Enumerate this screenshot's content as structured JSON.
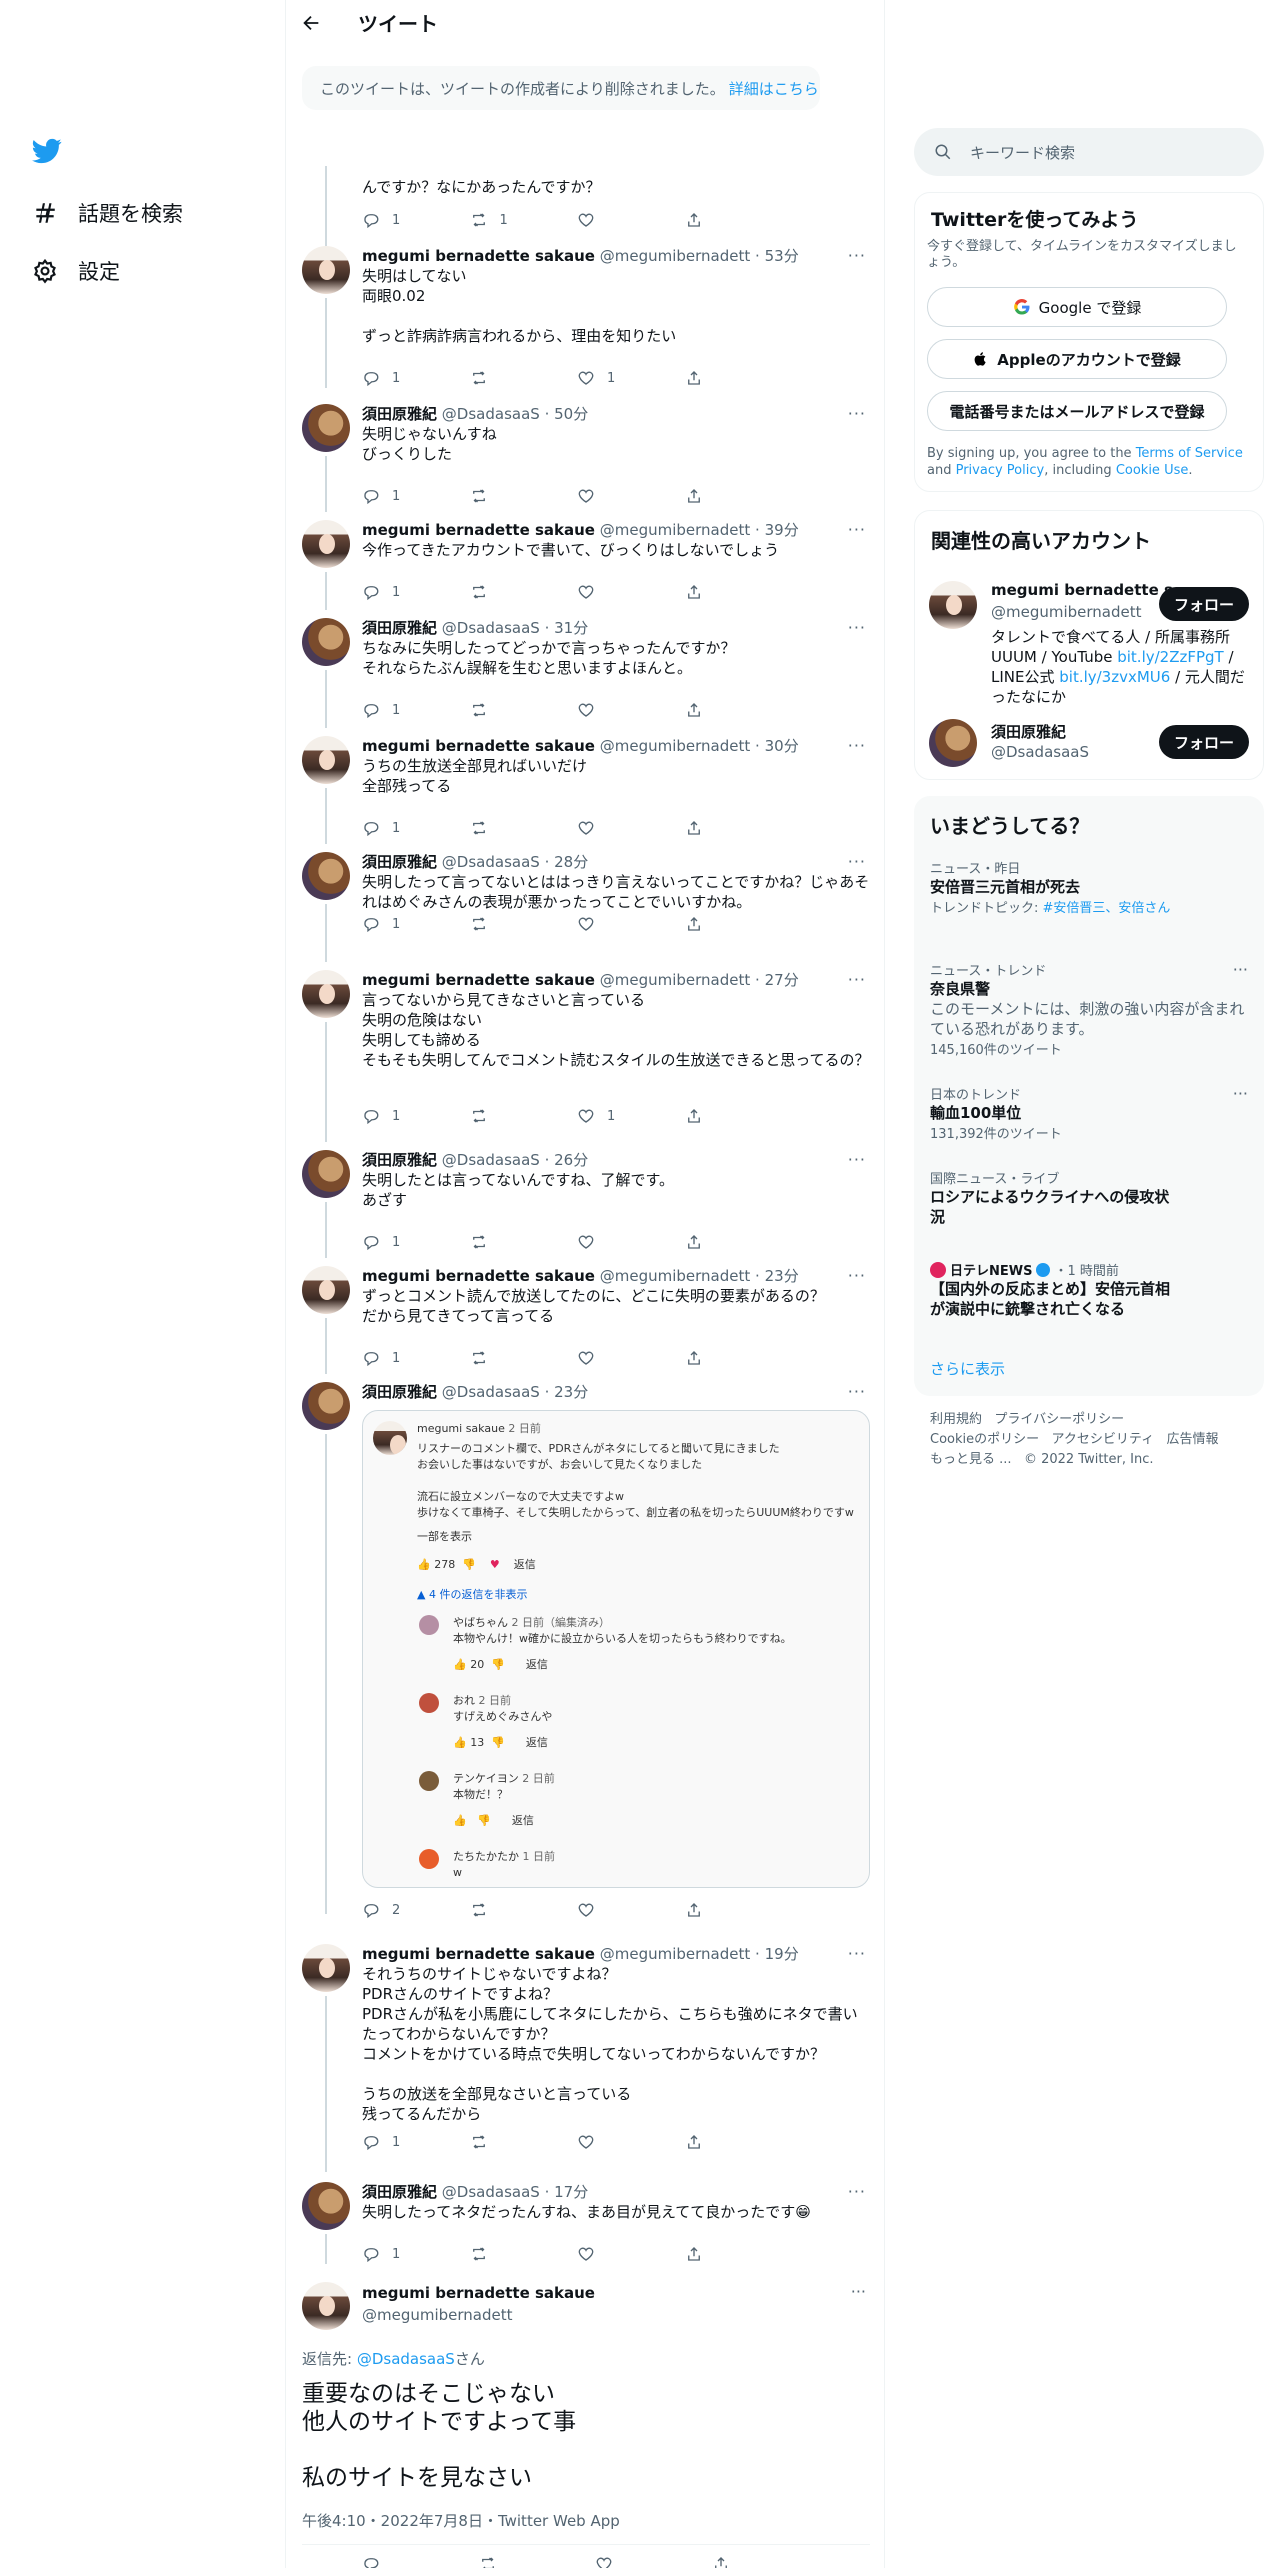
{
  "nav": {
    "explore_label": "話題を検索",
    "settings_label": "設定"
  },
  "header": {
    "title": "ツイート"
  },
  "deleted_notice": {
    "text": "このツイートは、ツイートの作成者により削除されました。",
    "link": "詳細はこちら"
  },
  "top_partial": {
    "text": "んですか？なにかあったんですか？",
    "reply": "1",
    "retweet": "1"
  },
  "tweets": [
    {
      "name": "megumi bernadette sakaue",
      "handle": "@megumibernadett",
      "time": "53分",
      "text": "失明はしてない\n両眼0.02\n\nずっと詐病詐病言われるから、理由を知りたい",
      "reply": "1",
      "retweet": "",
      "like": "1"
    },
    {
      "name": "須田原雅紀",
      "handle": "@DsadasaaS",
      "time": "50分",
      "text": "失明じゃないんすね\nびっくりした",
      "reply": "1",
      "retweet": "",
      "like": ""
    },
    {
      "name": "megumi bernadette sakaue",
      "handle": "@megumibernadett",
      "time": "39分",
      "text": "今作ってきたアカウントで書いて、びっくりはしないでしょう",
      "reply": "1",
      "retweet": "",
      "like": ""
    },
    {
      "name": "須田原雅紀",
      "handle": "@DsadasaaS",
      "time": "31分",
      "text": "ちなみに失明したってどっかで言っちゃったんですか？\nそれならたぶん誤解を生むと思いますよほんと。",
      "reply": "1",
      "retweet": "",
      "like": ""
    },
    {
      "name": "megumi bernadette sakaue",
      "handle": "@megumibernadett",
      "time": "30分",
      "text": "うちの生放送全部見ればいいだけ\n全部残ってる",
      "reply": "1",
      "retweet": "",
      "like": ""
    },
    {
      "name": "須田原雅紀",
      "handle": "@DsadasaaS",
      "time": "28分",
      "text": "失明したって言ってないとははっきり言えないってことですかね？じゃあそれはめぐみさんの表現が悪かったってことでいいすかね。",
      "reply": "1",
      "retweet": "",
      "like": ""
    },
    {
      "name": "megumi bernadette sakaue",
      "handle": "@megumibernadett",
      "time": "27分",
      "text": "言ってないから見てきなさいと言っている\n失明の危険はない\n失明しても諦める\nそもそも失明してんでコメント読むスタイルの生放送できると思ってるの？",
      "reply": "1",
      "retweet": "",
      "like": "1"
    },
    {
      "name": "須田原雅紀",
      "handle": "@DsadasaaS",
      "time": "26分",
      "text": "失明したとは言ってないんですね、了解です。\nあざす",
      "reply": "1",
      "retweet": "",
      "like": ""
    },
    {
      "name": "megumi bernadette sakaue",
      "handle": "@megumibernadett",
      "time": "23分",
      "text": "ずっとコメント読んで放送してたのに、どこに失明の要素があるの？\nだから見てきてって言ってる",
      "reply": "1",
      "retweet": "",
      "like": ""
    },
    {
      "name": "須田原雅紀",
      "handle": "@DsadasaaS",
      "time": "23分",
      "text": "",
      "reply": "2",
      "retweet": "",
      "like": ""
    },
    {
      "name": "megumi bernadette sakaue",
      "handle": "@megumibernadett",
      "time": "19分",
      "text": "それうちのサイトじゃないですよね？\nPDRさんのサイトですよね？\nPDRさんが私を小馬鹿にしてネタにしたから、こちらも強めにネタで書いたってわからないんですか？\nコメントをかけている時点で失明してないってわからないんですか？\n\nうちの放送を全部見なさいと言っている\n残ってるんだから",
      "reply": "1",
      "retweet": "",
      "like": ""
    },
    {
      "name": "須田原雅紀",
      "handle": "@DsadasaaS",
      "time": "17分",
      "text": "失明したってネタだったんすね、まあ目が見えてて良かったです😁",
      "reply": "1",
      "retweet": "",
      "like": ""
    }
  ],
  "embed": {
    "author": "megumi sakaue",
    "author_time": "2 日前",
    "comment": "リスナーのコメント欄で、PDRさんがネタにしてると聞いて見にきました\nお会いした事はないですが、お会いして見たくなりました\n\n流石に設立メンバーなので大丈夫ですよw\n歩けなくて車椅子、そして失明したからって、創立者の私を切ったらUUUM終わりですw",
    "show_more": "一部を表示",
    "likes": "278",
    "reply_label": "返信",
    "hide_replies": "4 件の返信を非表示",
    "replies": [
      {
        "name": "やばちゃん",
        "time": "2 日前（編集済み）",
        "text": "本物やんけ！w確かに設立からいる人を切ったらもう終わりですね。",
        "likes": "20"
      },
      {
        "name": "おれ",
        "time": "2 日前",
        "text": "すげえめぐみさんや",
        "likes": "13"
      },
      {
        "name": "テンケイヨン",
        "time": "2 日前",
        "text": "本物だ！？",
        "likes": ""
      },
      {
        "name": "たちたかたか",
        "time": "1 日前",
        "text": "w",
        "likes": ""
      }
    ]
  },
  "focus": {
    "name": "megumi bernadette sakaue",
    "handle": "@megumibernadett",
    "reply_to_prefix": "返信先: ",
    "reply_to": "@DsadasaaS",
    "reply_to_suffix": "さん",
    "text": "重要なのはそこじゃない\n他人のサイトですよって事\n\n私のサイトを見なさい",
    "meta": "午後4:10・2022年7月8日・Twitter Web App"
  },
  "search": {
    "placeholder": "キーワード検索"
  },
  "signup": {
    "title": "Twitterを使ってみよう",
    "subtitle": "今すぐ登録して、タイムラインをカスタマイズしましょう。",
    "google": "Google で登録",
    "apple": "Appleのアカウントで登録",
    "phone": "電話番号またはメールアドレスで登録",
    "terms_prefix": "By signing up, you agree to the ",
    "terms": "Terms of Service",
    "and": " and ",
    "privacy": "Privacy Policy",
    "including": ", including ",
    "cookie": "Cookie Use",
    "period": "."
  },
  "relevant": {
    "title": "関連性の高いアカウント",
    "follow_label": "フォロー",
    "accounts": [
      {
        "name": "megumi bernadette s...",
        "handle": "@megumibernadett",
        "bio_1": "タレントで食べてる人 / 所属事務所",
        "bio_2": "UUUM / YouTube ",
        "link1": "bit.ly/2ZzFPgT",
        "bio_3": " /",
        "bio_4": "LINE公式 ",
        "link2": "bit.ly/3zvxMU6",
        "bio_5": " / 元人間だ",
        "bio_6": "ったなにか"
      },
      {
        "name": "須田原雅紀",
        "handle": "@DsadasaaS"
      }
    ]
  },
  "trends": {
    "title": "いまどうしてる？",
    "items": [
      {
        "category": "ニュース・昨日",
        "title": "安倍晋三元首相が死去",
        "topic_label": "トレンドトピック: ",
        "topic": "#安倍晋三、安倍さん"
      },
      {
        "category": "ニュース・トレンド",
        "title": "奈良県警",
        "warning": "このモーメントには、刺激の強い内容が含まれている恐れがあります。",
        "count": "145,160件のツイート"
      },
      {
        "category": "日本のトレンド",
        "title": "輸血100単位",
        "count": "131,392件のツイート"
      },
      {
        "category": "国際ニュース・ライブ",
        "title": "ロシアによるウクライナへの侵攻状況"
      },
      {
        "category_source": "日テレNEWS",
        "category_time": "・1 時間前",
        "title": "【国内外の反応まとめ】安倍元首相が演説中に銃撃され亡くなる"
      }
    ],
    "show_more": "さらに表示"
  },
  "footer": {
    "terms": "利用規約",
    "privacy": "プライバシーポリシー",
    "cookie": "Cookieのポリシー",
    "accessibility": "アクセシビリティ",
    "ads": "広告情報",
    "more": "もっと見る ...",
    "copyright": "© 2022 Twitter, Inc."
  }
}
